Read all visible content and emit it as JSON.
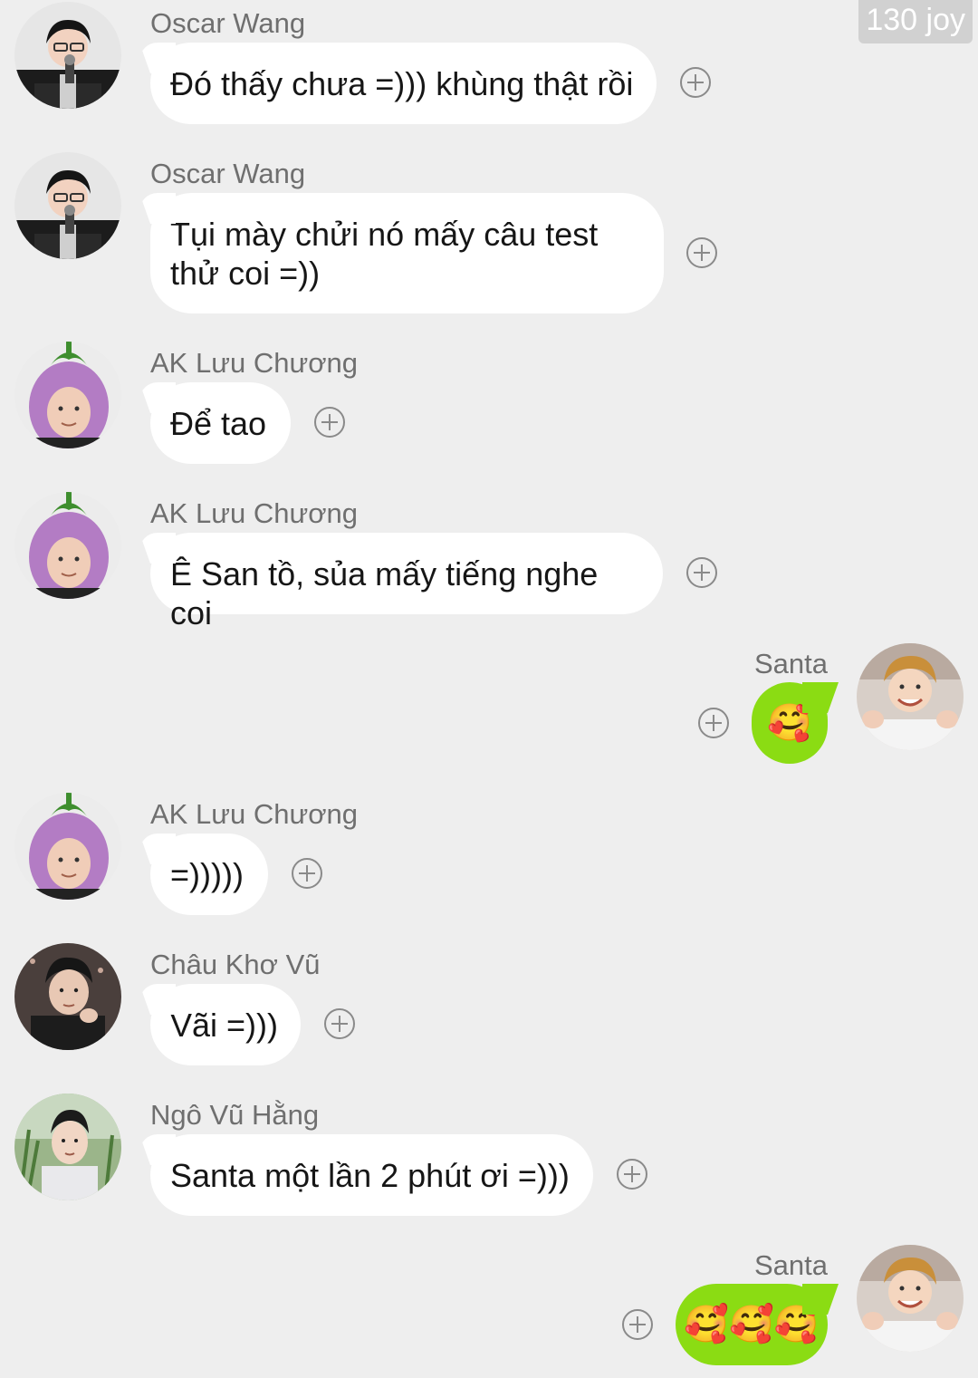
{
  "watermark": "130 joy",
  "messages": [
    {
      "sender": "Oscar Wang",
      "text": "Đó thấy chưa =))) khùng thật rồi"
    },
    {
      "sender": "Oscar Wang",
      "text": "Tụi mày chửi nó mấy câu test\nthử coi =))"
    },
    {
      "sender": "AK Lưu Chương",
      "text": "Để tao"
    },
    {
      "sender": "AK Lưu Chương",
      "text": "Ê San tồ, sủa mấy tiếng nghe coi"
    },
    {
      "sender": "Santa",
      "text": "🥰"
    },
    {
      "sender": "AK Lưu Chương",
      "text": "=)))))"
    },
    {
      "sender": "Châu Khơ Vũ",
      "text": "Vãi =)))"
    },
    {
      "sender": "Ngô Vũ Hằng",
      "text": "Santa một lần 2 phút ơi =)))"
    },
    {
      "sender": "Santa",
      "text": "🥰🥰🥰"
    }
  ],
  "colors": {
    "background": "#eeeeee",
    "incoming_bubble": "#ffffff",
    "outgoing_bubble": "#8bdc13",
    "sender_name": "#6f6f6f"
  },
  "icons": {
    "add_reaction": "plus-circle-icon"
  }
}
